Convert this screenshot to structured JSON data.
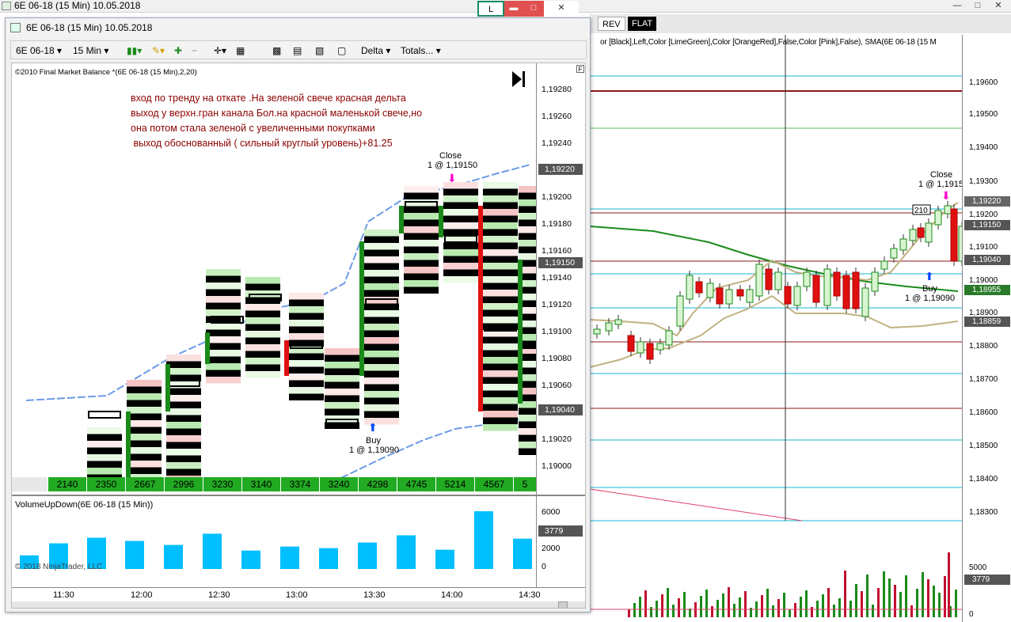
{
  "background_window": {
    "title": "6E 06-18 (15 Min)   10.05.2018",
    "toolbar": {
      "rev": "REV",
      "flat": "FLAT"
    },
    "indicator_info": "or [Black],Left,Color [LimeGreen],Color [OrangeRed],False,Color [Pink],False), SMA(6E 06-18 (15 M",
    "price_axis": [
      "1,19600",
      "1,19500",
      "1,19400",
      "1,19300",
      "1,19200",
      "1,19100",
      "1,19000",
      "1,18900",
      "1,18800",
      "1,18700",
      "1,18600",
      "1,18500",
      "1,18400",
      "1,18300"
    ],
    "price_boxes": [
      "1,19220",
      "1,19150",
      "1,19040",
      "1,18955",
      "1,18859"
    ],
    "volume_axis": [
      "5000",
      "3779",
      "0"
    ],
    "close_label": "Close",
    "close_fill": "1 @ 1,1915",
    "buy_label": "Buy",
    "buy_fill": "1 @ 1,19090",
    "bar_label": "210"
  },
  "front_window": {
    "title": "6E 06-18 (15 Min)   10.05.2018",
    "buttons": {
      "link": "L"
    },
    "toolbar": {
      "instrument": "6E 06-18",
      "interval": "15 Min",
      "delta": "Delta",
      "totals": "Totals..."
    },
    "indicator_label": "©2010 Final Market Balance *(6E 06-18 (15 Min),2,20)",
    "price_axis": [
      "1,19280",
      "1,19260",
      "1,19240",
      "1,19200",
      "1,19180",
      "1,19160",
      "1,19140",
      "1,19120",
      "1,19100",
      "1,19080",
      "1,19060",
      "1,19020",
      "1,19000"
    ],
    "price_boxes": [
      "1,19220",
      "1,19150",
      "1,19040"
    ],
    "note": "вход по тренду на откате .На зеленой свече красная дельта\nвыход у верхн.гран канала Бол.на красной маленькой свече,но\nона потом стала зеленой с увеличенными покупками\n выход обоснованный ( сильный круглый уровень)+81.25",
    "close_label": "Close",
    "close_fill": "1 @ 1,19150",
    "buy_label": "Buy",
    "buy_fill": "1 @ 1,19090",
    "totals": [
      "2140",
      "2350",
      "2667",
      "2996",
      "3230",
      "3140",
      "3374",
      "3240",
      "4298",
      "4745",
      "5214",
      "4567",
      "5"
    ],
    "volume_panel": {
      "title": "VolumeUpDown(6E 06-18 (15 Min))",
      "copyright": "© 2018 NinjaTrader, LLC",
      "axis": [
        "6000",
        "4000",
        "2000",
        "0"
      ],
      "last_box": "3779",
      "bar_color": "#00bfff"
    },
    "time_axis": [
      "11:30",
      "12:00",
      "12:30",
      "13:00",
      "13:30",
      "14:00",
      "14:30"
    ]
  },
  "chart_data": {
    "type": "bar",
    "title": "VolumeUpDown(6E 06-18 (15 Min))",
    "categories": [
      "11:15",
      "11:30",
      "11:45",
      "12:00",
      "12:15",
      "12:30",
      "12:45",
      "13:00",
      "13:15",
      "13:30",
      "13:45",
      "14:00",
      "14:15",
      "14:30"
    ],
    "values": [
      1700,
      3200,
      3900,
      3500,
      3000,
      4400,
      2300,
      2800,
      2600,
      3300,
      4200,
      2400,
      7200,
      3779
    ],
    "ylim": [
      0,
      7500
    ],
    "ylabel": "",
    "xlabel": ""
  },
  "colors": {
    "up": "#1a8a1a",
    "down": "#e01010",
    "volume": "#00bfff",
    "note": "#8b0000"
  }
}
